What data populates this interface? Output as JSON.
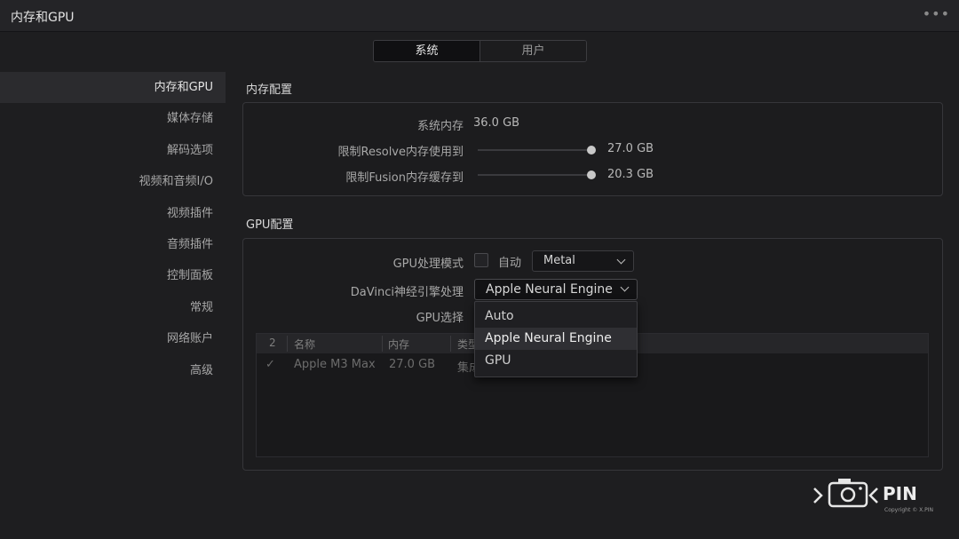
{
  "window": {
    "title": "内存和GPU",
    "more_label": "•••"
  },
  "tabs": [
    {
      "label": "系统",
      "active": true
    },
    {
      "label": "用户",
      "active": false
    }
  ],
  "sidebar": {
    "items": [
      {
        "label": "内存和GPU",
        "active": true
      },
      {
        "label": "媒体存储"
      },
      {
        "label": "解码选项"
      },
      {
        "label": "视频和音频I/O"
      },
      {
        "label": "视频插件"
      },
      {
        "label": "音频插件"
      },
      {
        "label": "控制面板"
      },
      {
        "label": "常规"
      },
      {
        "label": "网络账户"
      },
      {
        "label": "高级"
      }
    ]
  },
  "memory": {
    "title": "内存配置",
    "system_memory_label": "系统内存",
    "system_memory_value": "36.0 GB",
    "resolve_limit_label": "限制Resolve内存使用到",
    "resolve_limit_value": "27.0 GB",
    "fusion_limit_label": "限制Fusion内存缓存到",
    "fusion_limit_value": "20.3 GB"
  },
  "gpu": {
    "title": "GPU配置",
    "mode_label": "GPU处理模式",
    "auto_label": "自动",
    "auto_checked": false,
    "mode_value": "Metal",
    "neural_label": "DaVinci神经引擎处理",
    "neural_value": "Apple Neural Engine",
    "select_label": "GPU选择",
    "table": {
      "headers": [
        "2",
        "名称",
        "内存",
        "类型"
      ],
      "rows": [
        {
          "check": "✓",
          "name": "Apple M3 Max",
          "memory": "27.0 GB",
          "type": "集成"
        }
      ]
    }
  },
  "dropdown": {
    "options": [
      "Auto",
      "Apple Neural Engine",
      "GPU"
    ],
    "hovered": "Apple Neural Engine"
  },
  "watermark": {
    "text": "PIN",
    "caption": "Copyright © X.PIN"
  }
}
